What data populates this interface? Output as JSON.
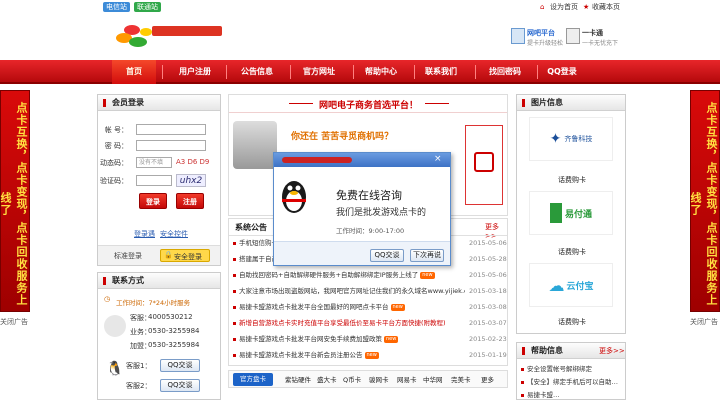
{
  "topbar": {
    "network_tabs": [
      {
        "label": "电信站",
        "color": "#3c8bd8"
      },
      {
        "label": "联通站",
        "color": "#30a84a"
      }
    ],
    "set_home": "设为首页",
    "favorite": "收藏本页"
  },
  "header": {
    "promo1": {
      "title": "网吧平台",
      "sub": "提卡升级轻松"
    },
    "promo2": {
      "title": "一卡通",
      "sub": "一卡无忧充下"
    }
  },
  "nav": {
    "items": [
      "首页",
      "用户注册",
      "公告信息",
      "官方网址",
      "帮助中心",
      "联系我们",
      "找回密码",
      "QQ登录"
    ]
  },
  "side_ad": {
    "text": "点卡互换，点卡变现，点卡回收服务上线了",
    "close": "关闭广告"
  },
  "login": {
    "title": "会员登录",
    "account_label": "帐 号：",
    "password_label": "密 码：",
    "dynamic_label": "动态码：",
    "dynamic_placeholder": "没有不填",
    "dynamic_code": "A3 D6 D9",
    "captcha_label": "验证码：",
    "captcha_image": "uhx2",
    "login_btn": "登录",
    "register_btn": "注册",
    "forgot": "登录遇",
    "safety": "安全控件",
    "standard_login": "标准登录",
    "secure_login": "安全登录"
  },
  "contact": {
    "title": "联系方式",
    "hours": "工作时间：7*24小时服务",
    "service_label": "客服：",
    "service": "4000530212",
    "business_label": "业务：",
    "business": "0530-3255984",
    "fax_label": "加盟：",
    "fax": "0530-3255984",
    "qq_label1": "客服1：",
    "qq_label2": "客服2：",
    "qq_btn": "QQ交谈"
  },
  "banner": {
    "slogan": "网吧电子商务首选平台！",
    "headline": "你还在 苦苦寻觅商机吗？"
  },
  "notice": {
    "title": "系统公告",
    "more": "更多>>",
    "new_badge": "new",
    "rows": [
      {
        "text": "手机短信购卡…",
        "date": "2015-05-06"
      },
      {
        "text": "搭建属于自己…",
        "date": "2015-05-28"
      },
      {
        "text": "自助找回密码+自助解绑硬件服务+自助解绑绑定IP服务上线了",
        "date": "2015-05-06"
      },
      {
        "text": "大家注意市场出现盗版网站，我网吧官方网址记住我们的永久域名www.yijiek.com",
        "date": "2015-03-18"
      },
      {
        "text": "易捷卡盟游戏点卡批发平台全国最好的网吧点卡平台",
        "date": "2015-03-08"
      },
      {
        "text": "新增自营游戏点卡实时充值平台享受最低价至易卡平台方面快捷(附教程)",
        "date": "2015-03-07"
      },
      {
        "text": "易捷卡盟游戏点卡批发平台网安免手续费加盟政策",
        "date": "2015-02-23"
      },
      {
        "text": "易捷卡盟游戏点卡批发平台新会员注册公告",
        "date": "2015-01-19"
      }
    ]
  },
  "popup": {
    "headline": "免费在线咨询",
    "subline": "我们是批发游戏点卡的",
    "hours": "工作时间：9:00-17:00",
    "qq_btn": "QQ交谈",
    "later_btn": "下次再说"
  },
  "tags": {
    "title": "官方盘卡",
    "items": [
      "紫钻硬件",
      "盛大卡",
      "Q币卡",
      "骏网卡",
      "网易卡",
      "中华网",
      "完美卡",
      "更多"
    ]
  },
  "pictures": {
    "title": "图片信息",
    "items": [
      {
        "brand": "齐鲁科技",
        "caption": "话费购卡"
      },
      {
        "brand": "易付通",
        "caption": "话费购卡"
      },
      {
        "brand": "云付宝",
        "caption": "话费购卡"
      }
    ]
  },
  "help": {
    "title": "帮助信息",
    "more": "更多>>",
    "rows": [
      "安全设置帐号解绑绑定",
      "【安全】绑定手机后可以自助…",
      "易捷卡盟…"
    ]
  }
}
